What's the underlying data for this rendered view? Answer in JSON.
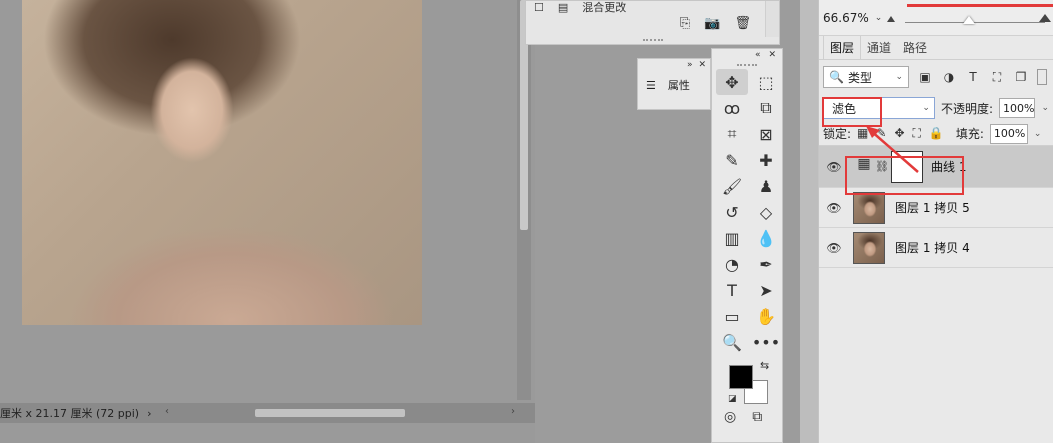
{
  "document": {
    "status_text": "厘米 x 21.17 厘米 (72 ppi)",
    "status_arrow": "›",
    "hscroll_left": "‹",
    "hscroll_right": "›"
  },
  "history": {
    "item_label": "混合更改"
  },
  "properties": {
    "label": "属性",
    "collapse": "»",
    "close": "✕"
  },
  "tools": {
    "collapse": "«",
    "close": "✕",
    "items": [
      {
        "name": "move-tool",
        "glyph": "✥"
      },
      {
        "name": "marquee-tool",
        "glyph": "⬚"
      },
      {
        "name": "lasso-tool",
        "glyph": "ꝏ"
      },
      {
        "name": "object-select-tool",
        "glyph": "⧉"
      },
      {
        "name": "crop-tool",
        "glyph": "⌗"
      },
      {
        "name": "frame-tool",
        "glyph": "⊠"
      },
      {
        "name": "eyedropper-tool",
        "glyph": "✎"
      },
      {
        "name": "healing-tool",
        "glyph": "✚"
      },
      {
        "name": "brush-tool",
        "glyph": "🖌"
      },
      {
        "name": "stamp-tool",
        "glyph": "♟"
      },
      {
        "name": "history-brush-tool",
        "glyph": "↺"
      },
      {
        "name": "eraser-tool",
        "glyph": "◇"
      },
      {
        "name": "gradient-tool",
        "glyph": "▥"
      },
      {
        "name": "blur-tool",
        "glyph": "💧"
      },
      {
        "name": "dodge-tool",
        "glyph": "◔"
      },
      {
        "name": "pen-tool",
        "glyph": "✒"
      },
      {
        "name": "type-tool",
        "glyph": "T"
      },
      {
        "name": "path-select-tool",
        "glyph": "➤"
      },
      {
        "name": "shape-tool",
        "glyph": "▭"
      },
      {
        "name": "hand-tool",
        "glyph": "✋"
      },
      {
        "name": "zoom-tool",
        "glyph": "🔍"
      },
      {
        "name": "more-tools",
        "glyph": "•••"
      }
    ],
    "swap": "⇆",
    "default_colors": "◪",
    "quick_mask": "◎",
    "screen_mode": "⧉"
  },
  "layers_panel": {
    "zoom": "66.67%",
    "zoom_dd": "⌄",
    "tabs": [
      "图层",
      "通道",
      "路径"
    ],
    "kind_label": "类型",
    "kind_icon": "🔍",
    "dropdown_glyph": "⌄",
    "filter_icons": [
      "▣",
      "◑",
      "T",
      "⛶",
      "❐"
    ],
    "blend_mode": "滤色",
    "opacity_label": "不透明度:",
    "opacity": "100%",
    "lock_label": "锁定:",
    "lock_icons": [
      "▦",
      "✎",
      "✥",
      "⛶",
      "🔒"
    ],
    "fill_label": "填充:",
    "fill": "100%",
    "eye": "👁",
    "layers": [
      {
        "name": "曲线 1",
        "type": "adjustment",
        "adj_icon": "▦",
        "chain": "⛓",
        "selected": true
      },
      {
        "name": "图层 1 拷贝 5",
        "type": "pixel",
        "selected": false
      },
      {
        "name": "图层 1 拷贝 4",
        "type": "pixel",
        "selected": false
      }
    ]
  },
  "annotation_color": "#e23a3a"
}
